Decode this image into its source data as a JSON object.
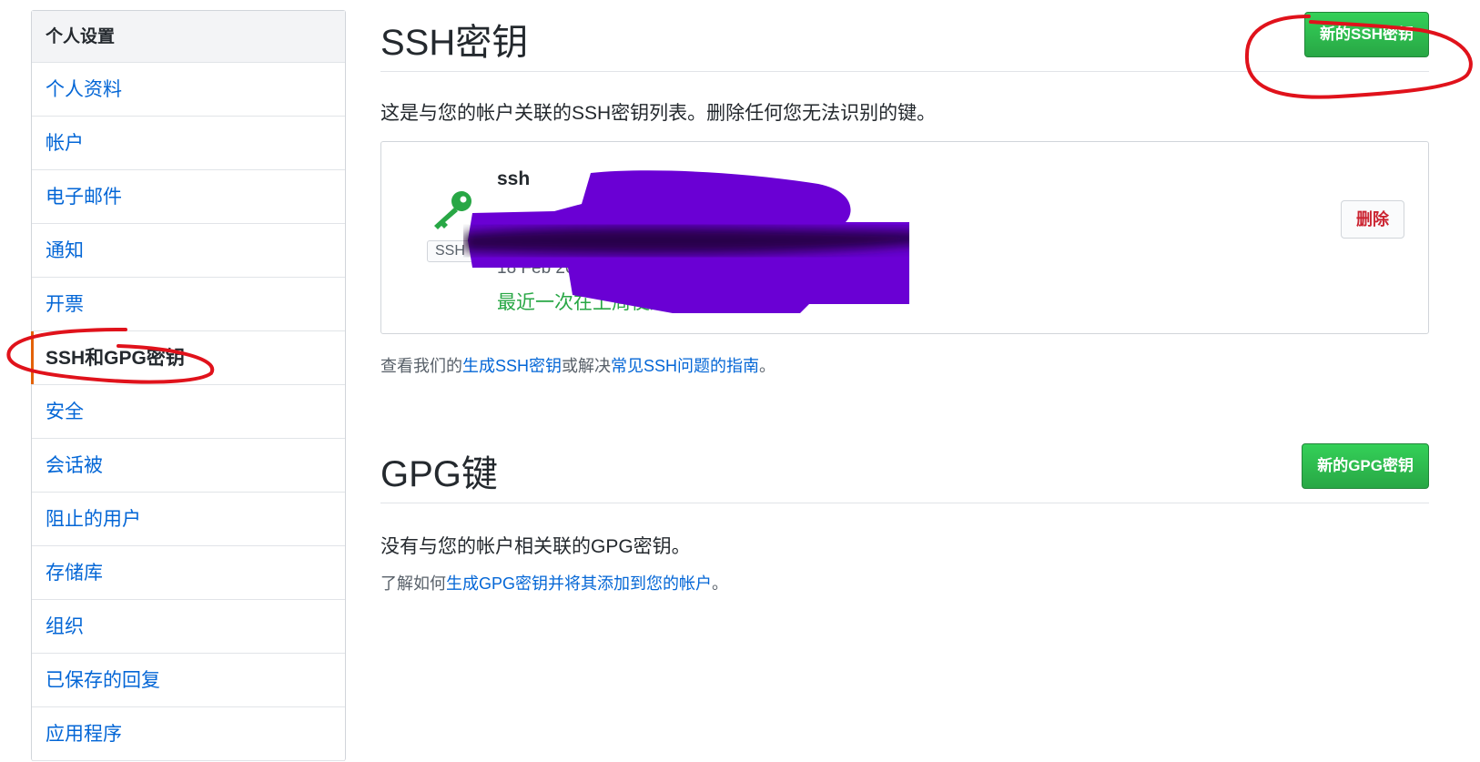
{
  "sidebar": {
    "header": "个人设置",
    "items": [
      {
        "label": "个人资料"
      },
      {
        "label": "帐户"
      },
      {
        "label": "电子邮件"
      },
      {
        "label": "通知"
      },
      {
        "label": "开票"
      },
      {
        "label": "SSH和GPG密钥"
      },
      {
        "label": "安全"
      },
      {
        "label": "会话被"
      },
      {
        "label": "阻止的用户"
      },
      {
        "label": "存储库"
      },
      {
        "label": "组织"
      },
      {
        "label": "已保存的回复"
      },
      {
        "label": "应用程序"
      }
    ],
    "selected_index": 5
  },
  "ssh": {
    "title": "SSH密钥",
    "new_button": "新的SSH密钥",
    "description": "这是与您的帐户关联的SSH密钥列表。删除任何您无法识别的键。",
    "key": {
      "title": "ssh",
      "type_badge": "SSH",
      "added_partial": "18 Feb 2019",
      "last_used": "最近一次在上周使用 - 读/写",
      "delete_button": "删除"
    },
    "help": {
      "prefix": "查看我们的",
      "link1": "生成SSH密钥",
      "middle": "或解决",
      "link2": "常见SSH问题的指南",
      "suffix": "。"
    }
  },
  "gpg": {
    "title": "GPG键",
    "new_button": "新的GPG密钥",
    "description": "没有与您的帐户相关联的GPG密钥。",
    "help": {
      "prefix": "了解如何",
      "link": "生成GPG密钥并将其添加到您的帐户",
      "suffix": "。"
    }
  },
  "colors": {
    "link": "#0366d6",
    "green_button": "#2cbe4e",
    "selected_accent": "#e36209",
    "danger": "#cb2431",
    "redaction": "#6a00d4",
    "annotation": "#e0121b"
  },
  "icons": {
    "key": "key-icon"
  }
}
